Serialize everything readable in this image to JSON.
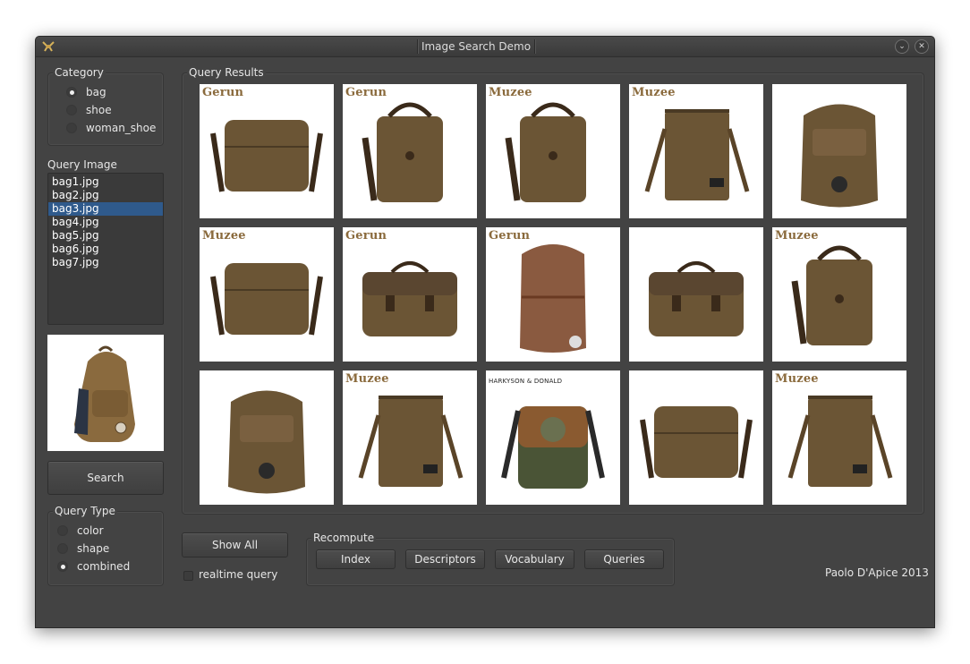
{
  "window": {
    "title": "Image Search Demo",
    "minimize_glyph": "⌄",
    "close_glyph": "✕"
  },
  "category": {
    "title": "Category",
    "options": [
      {
        "label": "bag",
        "selected": true
      },
      {
        "label": "shoe",
        "selected": false
      },
      {
        "label": "woman_shoe",
        "selected": false
      }
    ]
  },
  "query_image": {
    "label": "Query Image",
    "files": [
      "bag1.jpg",
      "bag2.jpg",
      "bag3.jpg",
      "bag4.jpg",
      "bag5.jpg",
      "bag6.jpg",
      "bag7.jpg"
    ],
    "selected": "bag3.jpg"
  },
  "search_button": "Search",
  "query_type": {
    "title": "Query Type",
    "options": [
      {
        "label": "color",
        "selected": false
      },
      {
        "label": "shape",
        "selected": false
      },
      {
        "label": "combined",
        "selected": true
      }
    ]
  },
  "results": {
    "title": "Query Results",
    "items": [
      {
        "brand": "Gerun",
        "kind": "messenger"
      },
      {
        "brand": "Gerun",
        "kind": "shoulder"
      },
      {
        "brand": "Muzee",
        "kind": "shoulder"
      },
      {
        "brand": "Muzee",
        "kind": "tote"
      },
      {
        "brand": "",
        "kind": "backpack"
      },
      {
        "brand": "Muzee",
        "kind": "messenger"
      },
      {
        "brand": "Gerun",
        "kind": "satchel"
      },
      {
        "brand": "Gerun",
        "kind": "backpack-red"
      },
      {
        "brand": "",
        "kind": "satchel"
      },
      {
        "brand": "Muzee",
        "kind": "shoulder"
      },
      {
        "brand": "",
        "kind": "backpack"
      },
      {
        "brand": "Muzee",
        "kind": "tote"
      },
      {
        "brand": "HARKYSON & DONALD",
        "kind": "shoulder-green"
      },
      {
        "brand": "",
        "kind": "messenger"
      },
      {
        "brand": "Muzee",
        "kind": "tote"
      }
    ]
  },
  "show_all_button": "Show All",
  "realtime_query": {
    "label": "realtime query",
    "checked": false
  },
  "recompute": {
    "title": "Recompute",
    "buttons": [
      "Index",
      "Descriptors",
      "Vocabulary",
      "Queries"
    ]
  },
  "credit": "Paolo D'Apice 2013",
  "colors": {
    "window_bg": "#434343",
    "selection": "#2f5a8c",
    "bag_brown": "#6b5535"
  }
}
